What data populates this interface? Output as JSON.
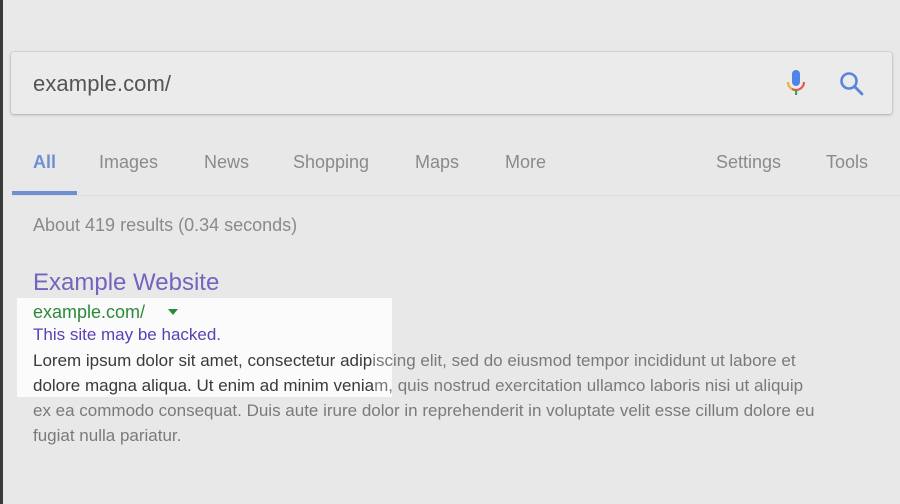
{
  "search": {
    "query": "example.com/",
    "mic_icon": "microphone-icon",
    "search_icon": "magnifier-icon"
  },
  "tabs": {
    "items": [
      {
        "label": "All",
        "active": true
      },
      {
        "label": "Images",
        "active": false
      },
      {
        "label": "News",
        "active": false
      },
      {
        "label": "Shopping",
        "active": false
      },
      {
        "label": "Maps",
        "active": false
      },
      {
        "label": "More",
        "active": false
      }
    ],
    "settings_label": "Settings",
    "tools_label": "Tools"
  },
  "results_stats": "About 419 results (0.34 seconds)",
  "result": {
    "title": "Example Website",
    "url": "example.com/",
    "warning": "This site may be hacked.",
    "snippet_lines": [
      {
        "highlighted": "Lorem ipsum dolor sit amet, consectetur adip",
        "rest": "iscing elit, sed do eiusmod tempor incididunt ut labore et"
      },
      {
        "highlighted": "dolore magna aliqua. Ut enim ad minim venia",
        "rest": "m, quis nostrud exercitation ullamco laboris nisi ut aliquip"
      },
      {
        "highlighted": "",
        "rest": "ex ea commodo consequat. Duis aute irure dolor in reprehenderit in voluptate velit esse cillum dolore eu"
      },
      {
        "highlighted": "",
        "rest": "fugiat nulla pariatur."
      }
    ]
  },
  "colors": {
    "accent_blue": "#6f8fd3",
    "title_purple": "#7563bd",
    "url_green": "#2b8a3a",
    "warning_purple": "#5a3fb4",
    "background": "#e8e8e8"
  }
}
